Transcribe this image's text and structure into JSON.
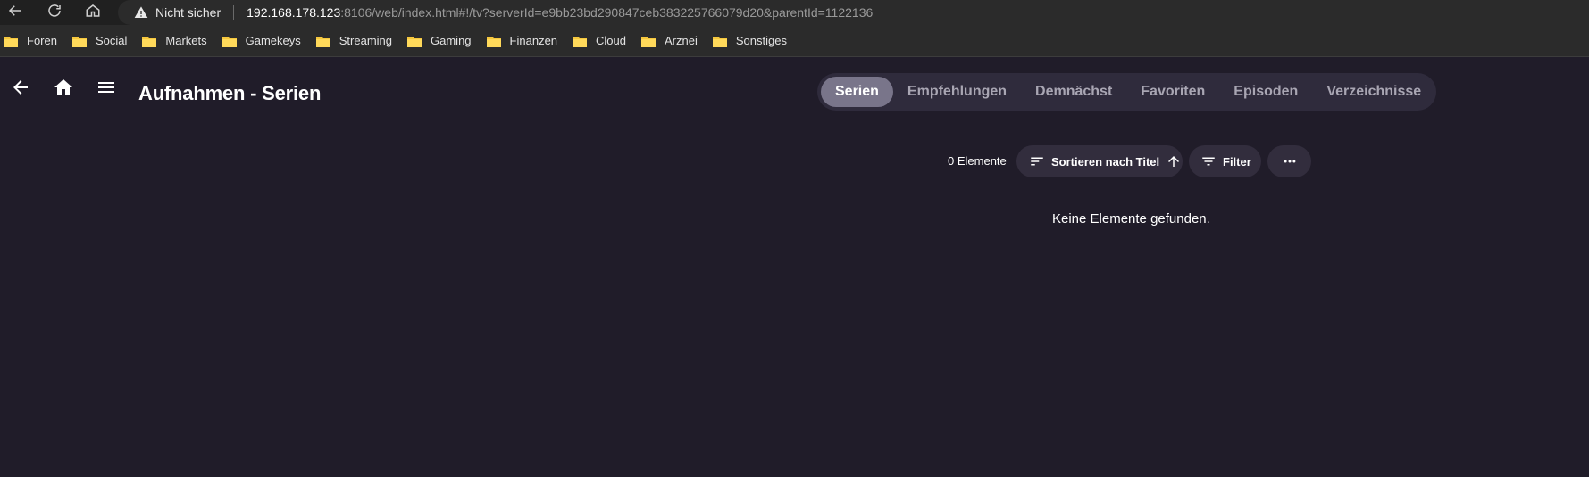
{
  "browser": {
    "security_label": "Nicht sicher",
    "url_host": "192.168.178.123",
    "url_rest": ":8106/web/index.html#!/tv?serverId=e9bb23bd290847ceb383225766079d20&parentId=1122136",
    "bookmarks": [
      {
        "label": "Foren",
        "icon": "folder-icon"
      },
      {
        "label": "Social",
        "icon": "folder-icon"
      },
      {
        "label": "Markets",
        "icon": "folder-icon"
      },
      {
        "label": "Gamekeys",
        "icon": "folder-icon"
      },
      {
        "label": "Streaming",
        "icon": "folder-icon"
      },
      {
        "label": "Gaming",
        "icon": "folder-icon"
      },
      {
        "label": "Finanzen",
        "icon": "folder-icon"
      },
      {
        "label": "Cloud",
        "icon": "folder-icon"
      },
      {
        "label": "Arznei",
        "icon": "folder-icon"
      },
      {
        "label": "Sonstiges",
        "icon": "folder-icon"
      }
    ]
  },
  "header": {
    "title": "Aufnahmen - Serien",
    "icons": [
      "back-arrow-icon",
      "home-icon",
      "menu-icon"
    ]
  },
  "tabs": [
    {
      "label": "Serien",
      "active": true
    },
    {
      "label": "Empfehlungen",
      "active": false
    },
    {
      "label": "Demnächst",
      "active": false
    },
    {
      "label": "Favoriten",
      "active": false
    },
    {
      "label": "Episoden",
      "active": false
    },
    {
      "label": "Verzeichnisse",
      "active": false
    }
  ],
  "controls": {
    "count_label": "0 Elemente",
    "sort_label": "Sortieren nach Titel",
    "filter_label": "Filter"
  },
  "empty_message": "Keine Elemente gefunden.",
  "colors": {
    "background": "#201c29",
    "tab_bar": "#2f2b3c",
    "tab_active": "#79758a",
    "button_bg": "#322d3d",
    "folder": "#f5c73d"
  }
}
